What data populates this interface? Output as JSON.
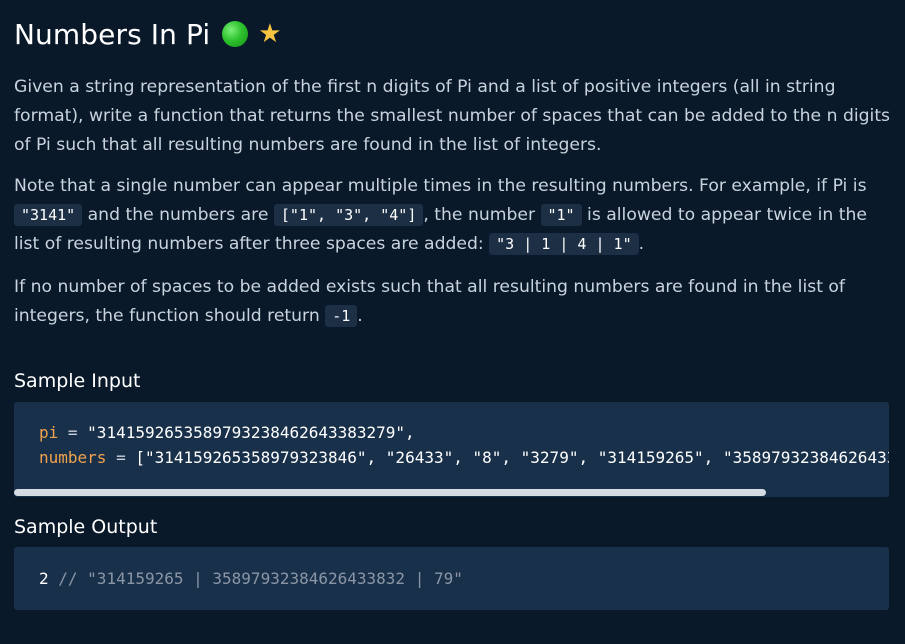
{
  "header": {
    "title": "Numbers In Pi",
    "difficulty_icon": "green-circle-icon",
    "favorite_icon": "star-icon",
    "difficulty_color": "#2ec22e",
    "star_color": "#f6c440"
  },
  "description": {
    "p1": "Given a string representation of the first n digits of Pi and a list of positive integers (all in string format), write a function that returns the smallest number of spaces that can be added to the n digits of Pi such that all resulting numbers are found in the list of integers.",
    "p2_a": "Note that a single number can appear multiple times in the resulting numbers. For example, if Pi is ",
    "p2_code1": "\"3141\"",
    "p2_b": " and the numbers are ",
    "p2_code2": "[\"1\", \"3\", \"4\"]",
    "p2_c": ", the number ",
    "p2_code3": "\"1\"",
    "p2_d": " is allowed to appear twice in the list of resulting numbers after three spaces are added: ",
    "p2_code4": "\"3 | 1 | 4 | 1\"",
    "p2_e": ".",
    "p3_a": "If no number of spaces to be added exists such that all resulting numbers are found in the list of integers, the function should return ",
    "p3_code": "-1",
    "p3_b": "."
  },
  "sample_input": {
    "heading": "Sample Input",
    "line1_var": "pi",
    "line1_op": " = ",
    "line1_val": "\"3141592653589793238462643383279\",",
    "line2_var": "numbers",
    "line2_op": " = ",
    "line2_val": "[\"314159265358979323846\", \"26433\", \"8\", \"3279\", \"314159265\", \"35897932384626433"
  },
  "sample_output": {
    "heading": "Sample Output",
    "value": "2",
    "comment": " // \"314159265 | 35897932384626433832 | 79\""
  }
}
